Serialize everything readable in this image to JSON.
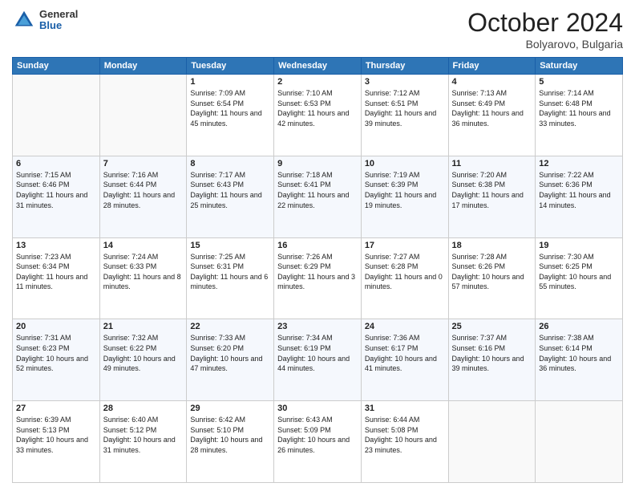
{
  "header": {
    "logo": {
      "general": "General",
      "blue": "Blue"
    },
    "title": "October 2024",
    "location": "Bolyarovo, Bulgaria"
  },
  "days_of_week": [
    "Sunday",
    "Monday",
    "Tuesday",
    "Wednesday",
    "Thursday",
    "Friday",
    "Saturday"
  ],
  "weeks": [
    [
      {
        "day": "",
        "sunrise": "",
        "sunset": "",
        "daylight": ""
      },
      {
        "day": "",
        "sunrise": "",
        "sunset": "",
        "daylight": ""
      },
      {
        "day": "1",
        "sunrise": "Sunrise: 7:09 AM",
        "sunset": "Sunset: 6:54 PM",
        "daylight": "Daylight: 11 hours and 45 minutes."
      },
      {
        "day": "2",
        "sunrise": "Sunrise: 7:10 AM",
        "sunset": "Sunset: 6:53 PM",
        "daylight": "Daylight: 11 hours and 42 minutes."
      },
      {
        "day": "3",
        "sunrise": "Sunrise: 7:12 AM",
        "sunset": "Sunset: 6:51 PM",
        "daylight": "Daylight: 11 hours and 39 minutes."
      },
      {
        "day": "4",
        "sunrise": "Sunrise: 7:13 AM",
        "sunset": "Sunset: 6:49 PM",
        "daylight": "Daylight: 11 hours and 36 minutes."
      },
      {
        "day": "5",
        "sunrise": "Sunrise: 7:14 AM",
        "sunset": "Sunset: 6:48 PM",
        "daylight": "Daylight: 11 hours and 33 minutes."
      }
    ],
    [
      {
        "day": "6",
        "sunrise": "Sunrise: 7:15 AM",
        "sunset": "Sunset: 6:46 PM",
        "daylight": "Daylight: 11 hours and 31 minutes."
      },
      {
        "day": "7",
        "sunrise": "Sunrise: 7:16 AM",
        "sunset": "Sunset: 6:44 PM",
        "daylight": "Daylight: 11 hours and 28 minutes."
      },
      {
        "day": "8",
        "sunrise": "Sunrise: 7:17 AM",
        "sunset": "Sunset: 6:43 PM",
        "daylight": "Daylight: 11 hours and 25 minutes."
      },
      {
        "day": "9",
        "sunrise": "Sunrise: 7:18 AM",
        "sunset": "Sunset: 6:41 PM",
        "daylight": "Daylight: 11 hours and 22 minutes."
      },
      {
        "day": "10",
        "sunrise": "Sunrise: 7:19 AM",
        "sunset": "Sunset: 6:39 PM",
        "daylight": "Daylight: 11 hours and 19 minutes."
      },
      {
        "day": "11",
        "sunrise": "Sunrise: 7:20 AM",
        "sunset": "Sunset: 6:38 PM",
        "daylight": "Daylight: 11 hours and 17 minutes."
      },
      {
        "day": "12",
        "sunrise": "Sunrise: 7:22 AM",
        "sunset": "Sunset: 6:36 PM",
        "daylight": "Daylight: 11 hours and 14 minutes."
      }
    ],
    [
      {
        "day": "13",
        "sunrise": "Sunrise: 7:23 AM",
        "sunset": "Sunset: 6:34 PM",
        "daylight": "Daylight: 11 hours and 11 minutes."
      },
      {
        "day": "14",
        "sunrise": "Sunrise: 7:24 AM",
        "sunset": "Sunset: 6:33 PM",
        "daylight": "Daylight: 11 hours and 8 minutes."
      },
      {
        "day": "15",
        "sunrise": "Sunrise: 7:25 AM",
        "sunset": "Sunset: 6:31 PM",
        "daylight": "Daylight: 11 hours and 6 minutes."
      },
      {
        "day": "16",
        "sunrise": "Sunrise: 7:26 AM",
        "sunset": "Sunset: 6:29 PM",
        "daylight": "Daylight: 11 hours and 3 minutes."
      },
      {
        "day": "17",
        "sunrise": "Sunrise: 7:27 AM",
        "sunset": "Sunset: 6:28 PM",
        "daylight": "Daylight: 11 hours and 0 minutes."
      },
      {
        "day": "18",
        "sunrise": "Sunrise: 7:28 AM",
        "sunset": "Sunset: 6:26 PM",
        "daylight": "Daylight: 10 hours and 57 minutes."
      },
      {
        "day": "19",
        "sunrise": "Sunrise: 7:30 AM",
        "sunset": "Sunset: 6:25 PM",
        "daylight": "Daylight: 10 hours and 55 minutes."
      }
    ],
    [
      {
        "day": "20",
        "sunrise": "Sunrise: 7:31 AM",
        "sunset": "Sunset: 6:23 PM",
        "daylight": "Daylight: 10 hours and 52 minutes."
      },
      {
        "day": "21",
        "sunrise": "Sunrise: 7:32 AM",
        "sunset": "Sunset: 6:22 PM",
        "daylight": "Daylight: 10 hours and 49 minutes."
      },
      {
        "day": "22",
        "sunrise": "Sunrise: 7:33 AM",
        "sunset": "Sunset: 6:20 PM",
        "daylight": "Daylight: 10 hours and 47 minutes."
      },
      {
        "day": "23",
        "sunrise": "Sunrise: 7:34 AM",
        "sunset": "Sunset: 6:19 PM",
        "daylight": "Daylight: 10 hours and 44 minutes."
      },
      {
        "day": "24",
        "sunrise": "Sunrise: 7:36 AM",
        "sunset": "Sunset: 6:17 PM",
        "daylight": "Daylight: 10 hours and 41 minutes."
      },
      {
        "day": "25",
        "sunrise": "Sunrise: 7:37 AM",
        "sunset": "Sunset: 6:16 PM",
        "daylight": "Daylight: 10 hours and 39 minutes."
      },
      {
        "day": "26",
        "sunrise": "Sunrise: 7:38 AM",
        "sunset": "Sunset: 6:14 PM",
        "daylight": "Daylight: 10 hours and 36 minutes."
      }
    ],
    [
      {
        "day": "27",
        "sunrise": "Sunrise: 6:39 AM",
        "sunset": "Sunset: 5:13 PM",
        "daylight": "Daylight: 10 hours and 33 minutes."
      },
      {
        "day": "28",
        "sunrise": "Sunrise: 6:40 AM",
        "sunset": "Sunset: 5:12 PM",
        "daylight": "Daylight: 10 hours and 31 minutes."
      },
      {
        "day": "29",
        "sunrise": "Sunrise: 6:42 AM",
        "sunset": "Sunset: 5:10 PM",
        "daylight": "Daylight: 10 hours and 28 minutes."
      },
      {
        "day": "30",
        "sunrise": "Sunrise: 6:43 AM",
        "sunset": "Sunset: 5:09 PM",
        "daylight": "Daylight: 10 hours and 26 minutes."
      },
      {
        "day": "31",
        "sunrise": "Sunrise: 6:44 AM",
        "sunset": "Sunset: 5:08 PM",
        "daylight": "Daylight: 10 hours and 23 minutes."
      },
      {
        "day": "",
        "sunrise": "",
        "sunset": "",
        "daylight": ""
      },
      {
        "day": "",
        "sunrise": "",
        "sunset": "",
        "daylight": ""
      }
    ]
  ]
}
